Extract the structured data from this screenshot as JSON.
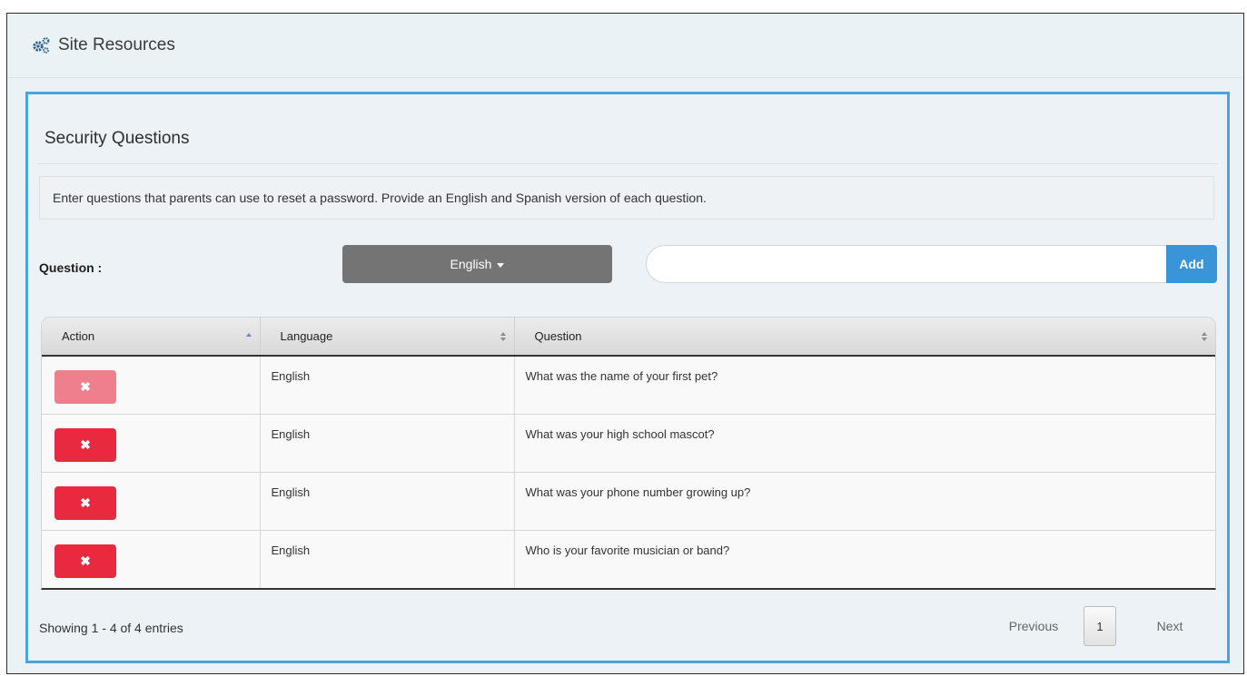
{
  "header": {
    "title": "Site Resources",
    "icon": "gears-icon"
  },
  "panel": {
    "title": "Security Questions",
    "info": "Enter questions that parents can use to reset a password. Provide an English and Spanish version of each question."
  },
  "form": {
    "question_label": "Question :",
    "language_selected": "English",
    "question_value": "",
    "add_label": "Add"
  },
  "table": {
    "columns": [
      "Action",
      "Language",
      "Question"
    ],
    "rows": [
      {
        "language": "English",
        "question": "What was the name of your first pet?"
      },
      {
        "language": "English",
        "question": "What was your high school mascot?"
      },
      {
        "language": "English",
        "question": "What was your phone number growing up?"
      },
      {
        "language": "English",
        "question": "Who is your favorite musician or band?"
      }
    ],
    "delete_glyph": "✖"
  },
  "footer": {
    "showing": "Showing 1 - 4 of 4 entries",
    "previous": "Previous",
    "page": "1",
    "next": "Next"
  },
  "colors": {
    "panel_border": "#4aa3df",
    "add_button": "#3a95d8",
    "delete_button": "#e8293e",
    "language_button": "#747474"
  }
}
